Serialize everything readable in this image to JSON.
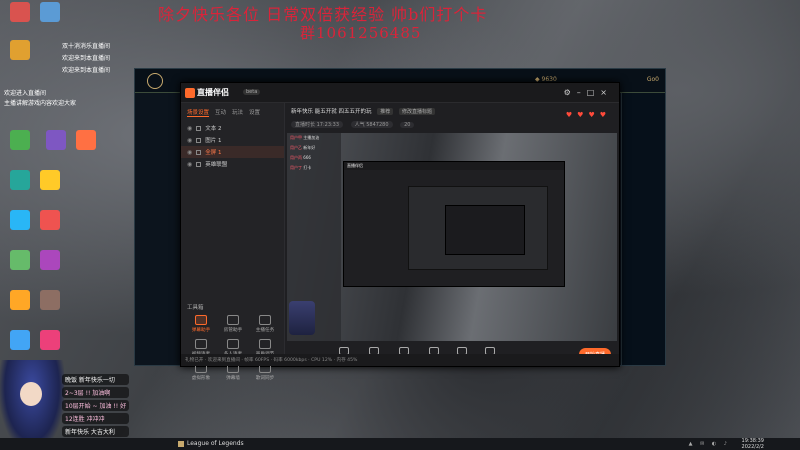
{
  "overlay": {
    "line1": "除夕快乐各位     日常双倍获经验  帅b们打个卡",
    "line2": "群1061256485"
  },
  "desktop": {
    "icons": [
      "",
      "",
      "",
      "",
      "",
      "",
      "",
      "",
      "",
      "",
      "",
      "",
      "",
      "",
      "",
      ""
    ],
    "notification": [
      "双十消消乐直播间",
      "欢迎来到本直播间",
      "欢迎来到本直播间",
      "欢迎进入直播间",
      "主播讲解游戏内容欢迎大家"
    ]
  },
  "lol_client": {
    "coins": "9630",
    "user": "Go0",
    "side_rows": [
      "",
      "",
      "",
      "",
      ""
    ]
  },
  "companion": {
    "app_name": "直播伴侣",
    "version": "beta",
    "left_tabs": [
      "场景设置",
      "互动",
      "玩法",
      "设置"
    ],
    "layers": [
      {
        "name": "文本 2"
      },
      {
        "name": "图片 1"
      },
      {
        "name": "全屏 1"
      },
      {
        "name": "英雄联盟"
      }
    ],
    "tools_label": "工具箱",
    "tools": [
      {
        "label": "弹幕助手"
      },
      {
        "label": "房管助手"
      },
      {
        "label": "主播任务"
      },
      {
        "label": "视频连麦"
      },
      {
        "label": "多人连麦"
      },
      {
        "label": "画质调节"
      },
      {
        "label": "虚拟形象"
      },
      {
        "label": "弹幕墙"
      },
      {
        "label": "歌词同步"
      }
    ],
    "stream_title": "新年快乐 能五开就 四五五开的玩",
    "title_tag1": "推荐",
    "title_tag2": "修改直播标题",
    "stats": [
      {
        "label": "直播时长 17:23:33"
      },
      {
        "label": "人气 5847280"
      },
      {
        "label": "20"
      }
    ],
    "nested_title": "直播伴侣",
    "chat": [
      {
        "name": "用户甲",
        "text": "主播加油"
      },
      {
        "name": "用户乙",
        "text": "新年好"
      },
      {
        "name": "用户丙",
        "text": "666"
      },
      {
        "name": "用户丁",
        "text": "打卡"
      }
    ],
    "bottom_bar": [
      {
        "label": "直播屏幕"
      },
      {
        "label": "摄像头"
      },
      {
        "label": "手机投屏"
      },
      {
        "label": "多媒体"
      },
      {
        "label": "麦克风"
      },
      {
        "label": "扬声器"
      }
    ],
    "start_button": "开始直播",
    "status_text": "礼物已开 · 欢迎来到直播间 · 帧率 60FPS · 码率 6000kbps · CPU 12% · 内存 45%"
  },
  "vtuber_chat": [
    {
      "text": "晚饭 新年快乐一切"
    },
    {
      "text": "2~3层 !! 加油啊"
    },
    {
      "text": "10层开始 ~ 加油 !! 好"
    },
    {
      "text": "12连胜 冲冲冲"
    },
    {
      "text": "新年快乐 大吉大利"
    }
  ],
  "taskbar": {
    "app": "League of Legends",
    "time": "19:38:39",
    "date": "2022/2/2"
  }
}
